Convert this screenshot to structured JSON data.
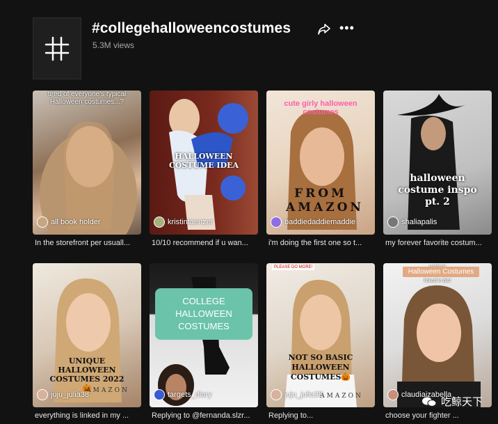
{
  "header": {
    "hashtag_symbol": "#",
    "title": "#collegehalloweencostumes",
    "views": "5.3M views"
  },
  "videos": [
    {
      "overlay": "tired of everyone's typical Halloween costumes...?",
      "author": "all book holder",
      "caption": "In the storefront per usuall..."
    },
    {
      "overlay": "HALLOWEEN COSTUME IDEA",
      "author": "kristintaenzer",
      "caption": "10/10 recommend if u wan..."
    },
    {
      "overlay": "cute girly halloween costumes",
      "overlay2": "FROM AMAZON",
      "author": "baddiedaddiemaddie",
      "caption": "i'm doing the first one so t..."
    },
    {
      "overlay": "halloween costume inspo pt. 2",
      "author": "shaliapalis",
      "caption": "my forever favorite costum..."
    },
    {
      "overlay": "UNIQUE HALLOWEEN COSTUMES 2022🎃",
      "overlay2": "AMAZON",
      "author": "juju_julia38",
      "caption": "everything is linked in my ..."
    },
    {
      "overlay": "COLLEGE HALLOWEEN COSTUMES",
      "author": "targets_diary",
      "caption": "Replying to @fernanda.slzr..."
    },
    {
      "overlay": "NOT SO BASIC HALLOWEEN COSTUMES🎃",
      "overlay_top": "PLEASE DO MORE!",
      "overlay2": "AMAZON",
      "author": "juju_julia38",
      "caption": "Replying to..."
    },
    {
      "overlay": "Halloween Costumes",
      "overlay_top": "unique",
      "overlay_sub": "linked in bio!",
      "author": "claudiaizabella_",
      "caption": "choose your fighter ..."
    }
  ],
  "watermark": {
    "text": "吃鲸天下"
  }
}
